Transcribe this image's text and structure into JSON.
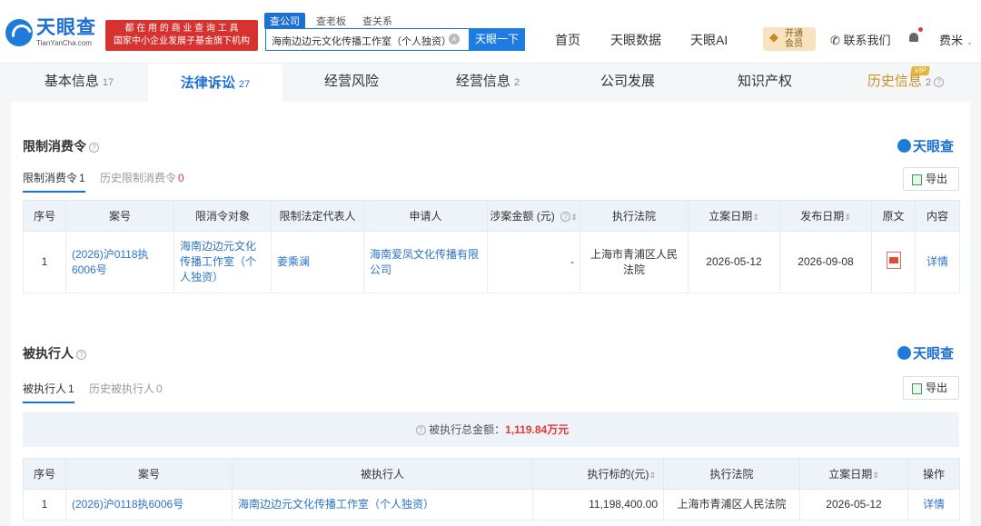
{
  "header": {
    "logo_cn": "天眼查",
    "logo_en": "TianYanCha.com",
    "slogan_line1": "都 在 用 的 商 业 查 询 工 具",
    "slogan_line2": "国家中小企业发展子基金旗下机构",
    "search_tabs": [
      "查公司",
      "查老板",
      "查关系"
    ],
    "search_value": "海南边边元文化传播工作室（个人独资）",
    "search_button": "天眼一下",
    "nav": [
      "首页",
      "天眼数据",
      "天眼AI"
    ],
    "vip_label_1": "开通",
    "vip_label_2": "会员",
    "contact": "联系我们",
    "user": "费米"
  },
  "tabs": [
    {
      "label": "基本信息",
      "count": "17"
    },
    {
      "label": "法律诉讼",
      "count": "27"
    },
    {
      "label": "经营风险",
      "count": ""
    },
    {
      "label": "经营信息",
      "count": "2"
    },
    {
      "label": "公司发展",
      "count": ""
    },
    {
      "label": "知识产权",
      "count": ""
    },
    {
      "label": "历史信息",
      "count": "2"
    }
  ],
  "vip_tag": "VIP",
  "brand": "天眼查",
  "export_label": "导出",
  "restrict": {
    "title": "限制消费令",
    "subtab_active": "限制消费令",
    "subtab_active_count": "1",
    "subtab_history": "历史限制消费令",
    "subtab_history_count": "0",
    "headers": [
      "序号",
      "案号",
      "限消令对象",
      "限制法定代表人",
      "申请人",
      "涉案金额 (元)",
      "执行法院",
      "立案日期",
      "发布日期",
      "原文",
      "内容"
    ],
    "rows": [
      {
        "no": "1",
        "case_no": "(2026)沪0118执6006号",
        "target": "海南边边元文化传播工作室（个人独资）",
        "legal_rep": "姜乘澜",
        "applicant": "海南爱凤文化传播有限公司",
        "amount": "-",
        "court": "上海市青浦区人民法院",
        "filing_date": "2026-05-12",
        "publish_date": "2026-09-08",
        "detail": "详情"
      }
    ]
  },
  "executed": {
    "title": "被执行人",
    "subtab_active": "被执行人",
    "subtab_active_count": "1",
    "subtab_history": "历史被执行人",
    "subtab_history_count": "0",
    "summary_label": "被执行总金额：",
    "summary_amount": "1,119.84万元",
    "headers": [
      "序号",
      "案号",
      "被执行人",
      "执行标的(元)",
      "执行法院",
      "立案日期",
      "操作"
    ],
    "rows": [
      {
        "no": "1",
        "case_no": "(2026)沪0118执6006号",
        "name": "海南边边元文化传播工作室（个人独资）",
        "amount": "11,198,400.00",
        "court": "上海市青浦区人民法院",
        "filing_date": "2026-05-12",
        "action": "详情"
      }
    ]
  }
}
